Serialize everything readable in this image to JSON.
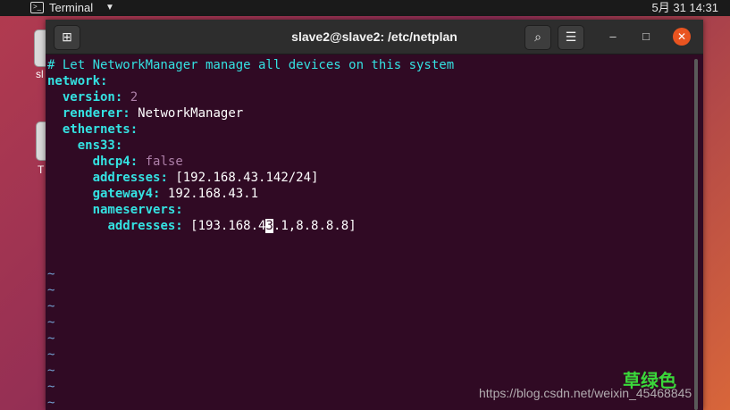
{
  "topbar": {
    "app_label": "Terminal",
    "app_icon": ">_",
    "caret": "▼",
    "clock": "5月 31  14:31"
  },
  "desktop": {
    "icon1_label": "sl",
    "icon2_label": "T"
  },
  "window": {
    "title": "slave2@slave2: /etc/netplan",
    "new_tab_icon": "⊞",
    "search_icon": "⌕",
    "menu_icon": "☰",
    "minimize_icon": "–",
    "maximize_icon": "□",
    "close_icon": "✕"
  },
  "terminal": {
    "comment": "# Let NetworkManager manage all devices on this system",
    "l_network": "network",
    "l_version_key": "version",
    "l_version_val": "2",
    "l_renderer_key": "renderer",
    "l_renderer_val": "NetworkManager",
    "l_ethernets_key": "ethernets",
    "l_ens33_key": "ens33",
    "l_dhcp4_key": "dhcp4",
    "l_dhcp4_val": "false",
    "l_addresses_key": "addresses",
    "l_addresses_val": "[192.168.43.142/24]",
    "l_gateway_key": "gateway4",
    "l_gateway_val": "192.168.43.1",
    "l_nameservers_key": "nameservers",
    "l_ns_addresses_key": "addresses",
    "l_ns_val_before": "[193.168.4",
    "l_ns_val_cursor": "3",
    "l_ns_val_after": ".1,8.8.8.8]",
    "tilde": "~"
  },
  "watermark": {
    "cn_text": "草绿色",
    "url": "https://blog.csdn.net/weixin_45468845"
  }
}
